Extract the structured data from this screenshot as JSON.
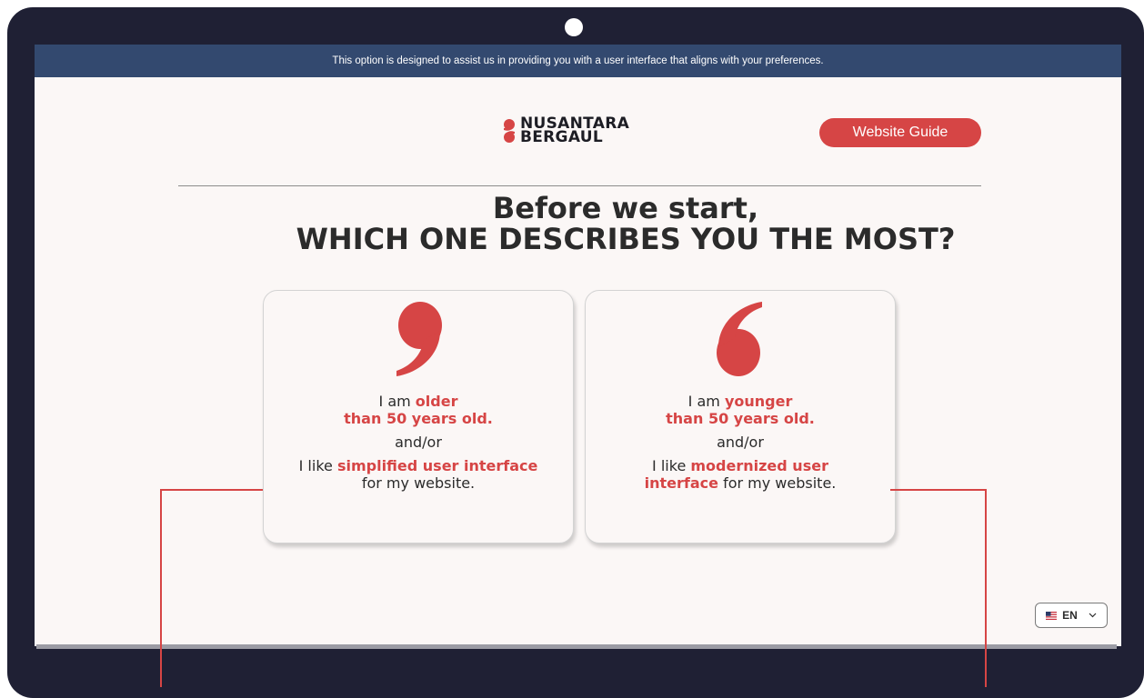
{
  "banner": {
    "text": "This option is designed to assist us in providing you with a user interface that aligns with your preferences."
  },
  "logo": {
    "line1": "NUSANTARA",
    "line2": "BERGAUL"
  },
  "header": {
    "guide_button": "Website Guide"
  },
  "heading": {
    "line1": "Before we start,",
    "line2": "WHICH ONE DESCRIBES YOU THE MOST?"
  },
  "options": [
    {
      "icon": "closing-quote-icon",
      "age_prefix": "I am ",
      "age_highlight_1": "older",
      "age_highlight_2": "than 50 years old.",
      "connector": "and/or",
      "pref_prefix": "I like ",
      "pref_highlight": "simplified user interface",
      "pref_suffix": "for my website."
    },
    {
      "icon": "opening-quote-icon",
      "age_prefix": "I am ",
      "age_highlight_1": "younger",
      "age_highlight_2": "than 50 years old.",
      "connector": "and/or",
      "pref_prefix": "I like ",
      "pref_highlight_1": "modernized user",
      "pref_highlight_2": "interface",
      "pref_suffix": " for my website."
    }
  ],
  "language": {
    "flag": "us-flag-icon",
    "code": "EN"
  },
  "colors": {
    "accent": "#d64545",
    "banner": "#33496f",
    "bezel": "#1f2034",
    "screen_bg": "#fbf7f6"
  }
}
